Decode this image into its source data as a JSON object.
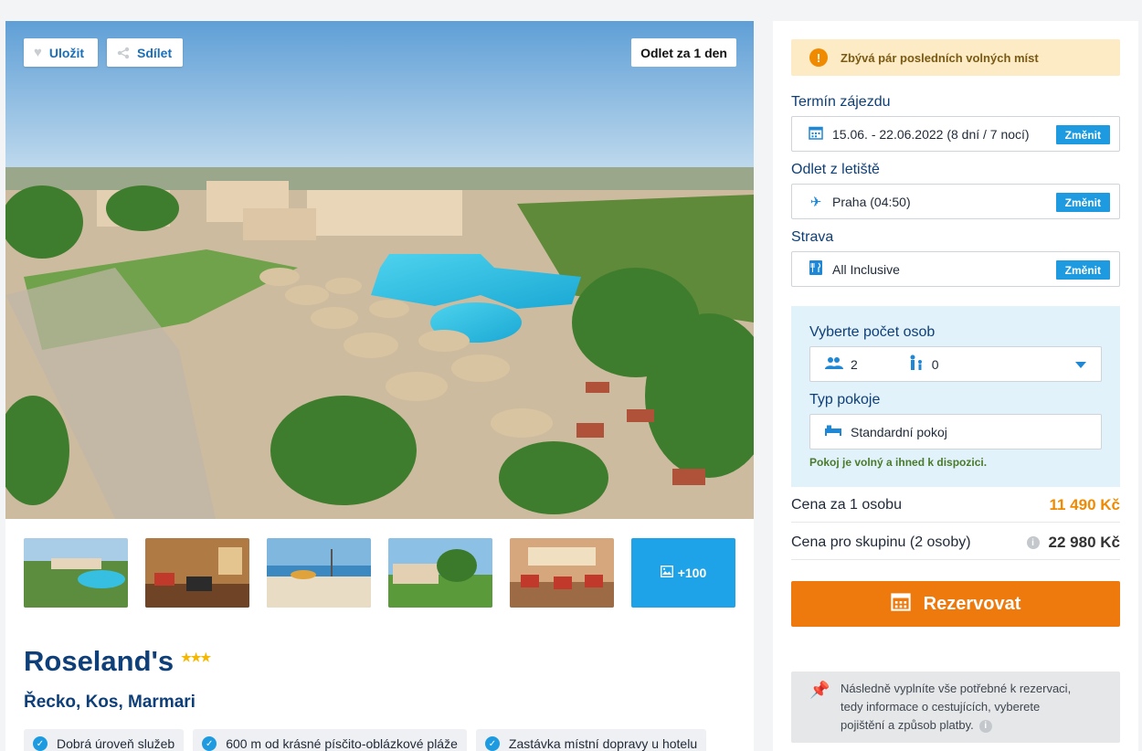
{
  "hero": {
    "save_label": "Uložit",
    "share_label": "Sdílet",
    "departure_badge": "Odlet za 1 den"
  },
  "gallery": {
    "more_label": "+100"
  },
  "hotel": {
    "name": "Roseland's",
    "stars": "★★★",
    "location": "Řecko, Kos, Marmari",
    "features": [
      "Dobrá úroveň služeb",
      "600 m od krásné písčito-oblázkové pláže",
      "Zastávka místní dopravy u hotelu"
    ]
  },
  "booking": {
    "alert": "Zbývá pár posledních volných míst",
    "term_label": "Termín zájezdu",
    "term_value": "15.06. - 22.06.2022 (8 dní / 7 nocí)",
    "airport_label": "Odlet z letiště",
    "airport_value": "Praha (04:50)",
    "board_label": "Strava",
    "board_value": "All Inclusive",
    "change_label": "Změnit",
    "persons_label": "Vyberte počet osob",
    "adults": "2",
    "children": "0",
    "room_label": "Typ pokoje",
    "room_value": "Standardní pokoj",
    "availability": "Pokoj je volný a ihned k dispozici.",
    "price_person_label": "Cena za 1 osobu",
    "price_person": "11 490 Kč",
    "price_group_label": "Cena pro skupinu (2 osoby)",
    "price_group": "22 980 Kč",
    "book_label": "Rezervovat",
    "note_line1": "Následně vyplníte vše potřebné k rezervaci,",
    "note_line2": "tedy informace o cestujících, vyberete",
    "note_line3": "pojištění a způsob platby."
  },
  "colors": {
    "brand_blue": "#0f3f78",
    "accent_blue": "#1e9be0",
    "orange": "#ee7a0e",
    "alert_bg": "#fcebc5"
  }
}
